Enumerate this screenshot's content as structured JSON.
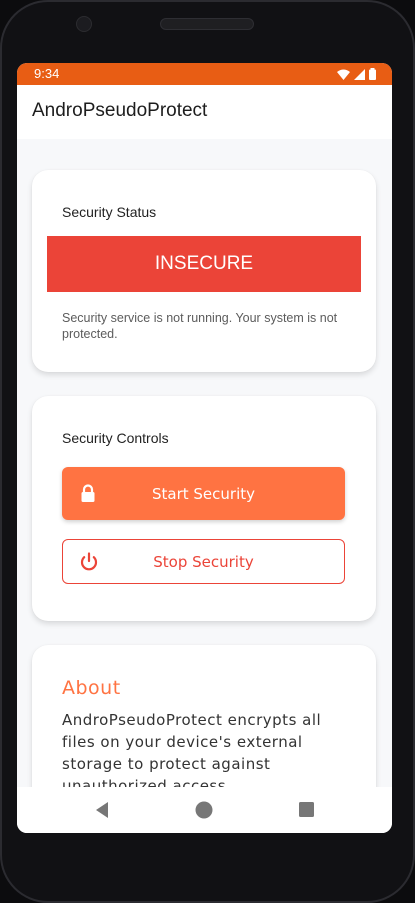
{
  "status_bar": {
    "time": "9:34",
    "icons": [
      "wifi-icon",
      "signal-icon",
      "battery-icon"
    ]
  },
  "app_bar": {
    "title": "AndroPseudoProtect"
  },
  "security_status": {
    "title": "Security Status",
    "state": "INSECURE",
    "message": "Security service is not running. Your system is not protected."
  },
  "security_controls": {
    "title": "Security Controls",
    "start_label": "Start Security",
    "stop_label": "Stop Security"
  },
  "about": {
    "title": "About",
    "text": "AndroPseudoProtect encrypts all files on your device's external storage to protect against unauthorized access."
  },
  "nav_bar": {
    "icons": [
      "back-icon",
      "home-icon",
      "recents-icon"
    ]
  },
  "colors": {
    "status_bar": "#e85d14",
    "insecure": "#eb4438",
    "accent": "#ff7342"
  }
}
